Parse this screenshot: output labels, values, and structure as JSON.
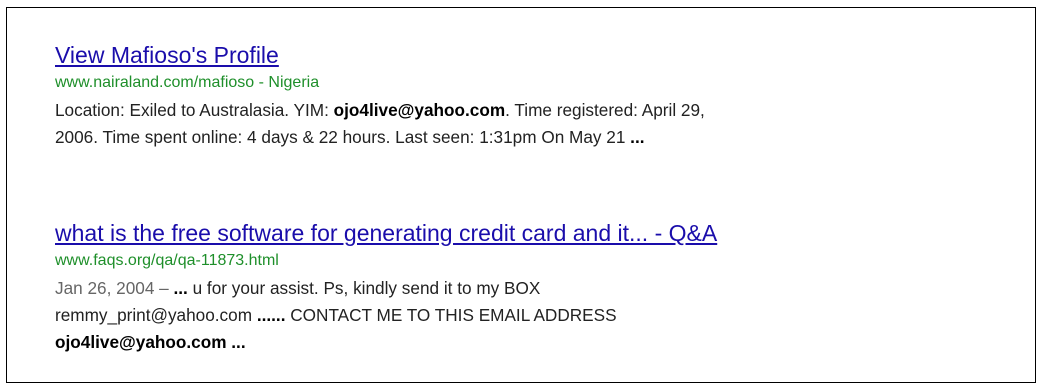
{
  "results": [
    {
      "title": "View Mafioso's Profile",
      "url": "www.nairaland.com/mafioso - Nigeria",
      "snippet": {
        "line1_a": "Location: Exiled to Australasia. YIM: ",
        "line1_b": "ojo4live@yahoo.com",
        "line1_c": ". Time registered: April 29,",
        "line2_a": "2006. Time spent online: 4 days & 22 hours. Last seen: 1:31pm On May 21 ",
        "line2_b": "..."
      }
    },
    {
      "title": "what is the free software for generating credit card and it... - Q&A",
      "url": "www.faqs.org/qa/qa-11873.html",
      "snippet": {
        "date": "Jan 26, 2004 – ",
        "line1_b": "...",
        "line1_c": " u for your assist. Ps, kindly send it to my BOX",
        "line2_a": "remmy_print@yahoo.com ",
        "line2_b": "......",
        "line2_c": " CONTACT ME TO THIS EMAIL ADDRESS",
        "line3_a": "ojo4live@yahoo.com ..."
      }
    }
  ],
  "colors": {
    "title_link": "#1a0dab",
    "url": "#1e8f2a",
    "snippet_text": "#222222",
    "date": "#666666",
    "border": "#000000"
  }
}
